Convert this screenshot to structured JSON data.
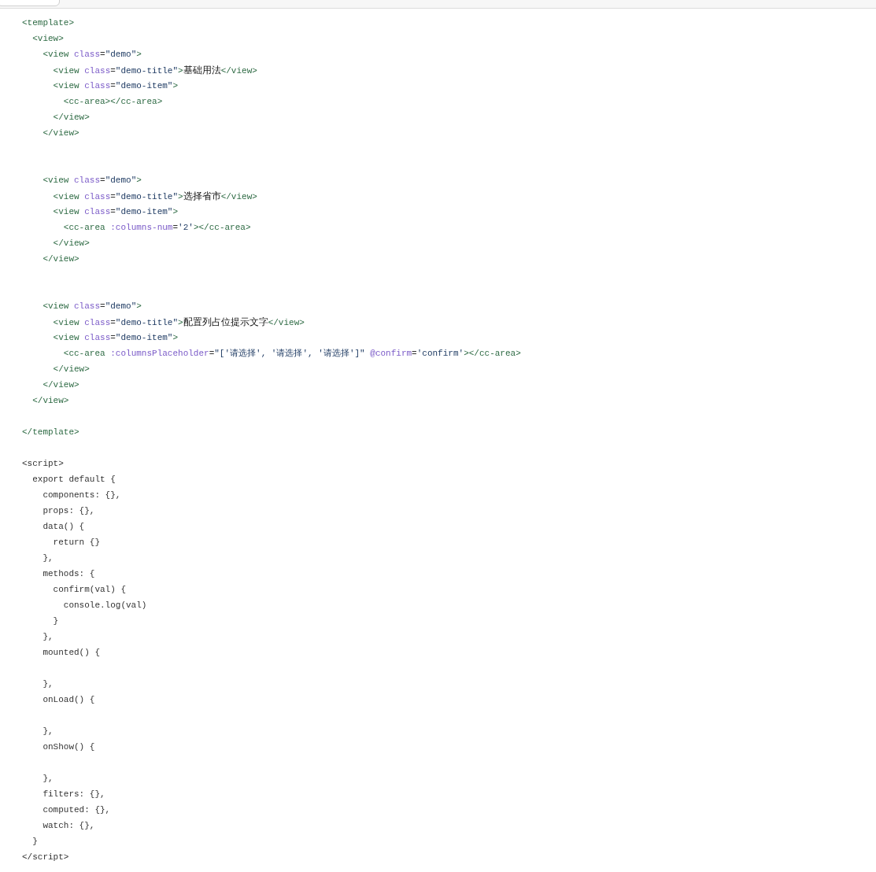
{
  "code": {
    "lines": [
      {
        "kind": "code",
        "tokens": [
          {
            "kind": "tag",
            "text": "<template>"
          }
        ]
      },
      {
        "kind": "code",
        "tokens": [
          {
            "kind": "tag",
            "text": "  <view>"
          }
        ]
      },
      {
        "kind": "code",
        "tokens": [
          {
            "kind": "tag",
            "text": "    <view"
          },
          {
            "kind": "attr",
            "text": " class"
          },
          {
            "kind": "plain",
            "text": "="
          },
          {
            "kind": "string",
            "text": "\"demo\""
          },
          {
            "kind": "tag",
            "text": ">"
          }
        ]
      },
      {
        "kind": "code",
        "tokens": [
          {
            "kind": "tag",
            "text": "      <view"
          },
          {
            "kind": "attr",
            "text": " class"
          },
          {
            "kind": "plain",
            "text": "="
          },
          {
            "kind": "string",
            "text": "\"demo-title\""
          },
          {
            "kind": "tag",
            "text": ">"
          },
          {
            "kind": "text",
            "text": "基础用法"
          },
          {
            "kind": "tag",
            "text": "</view>"
          }
        ]
      },
      {
        "kind": "code",
        "tokens": [
          {
            "kind": "tag",
            "text": "      <view"
          },
          {
            "kind": "attr",
            "text": " class"
          },
          {
            "kind": "plain",
            "text": "="
          },
          {
            "kind": "string",
            "text": "\"demo-item\""
          },
          {
            "kind": "tag",
            "text": ">"
          }
        ]
      },
      {
        "kind": "code",
        "tokens": [
          {
            "kind": "tag",
            "text": "        <cc-area></cc-area>"
          }
        ]
      },
      {
        "kind": "code",
        "tokens": [
          {
            "kind": "tag",
            "text": "      </view>"
          }
        ]
      },
      {
        "kind": "code",
        "tokens": [
          {
            "kind": "tag",
            "text": "    </view>"
          }
        ]
      },
      {
        "kind": "blank"
      },
      {
        "kind": "blank"
      },
      {
        "kind": "code",
        "tokens": [
          {
            "kind": "tag",
            "text": "    <view"
          },
          {
            "kind": "attr",
            "text": " class"
          },
          {
            "kind": "plain",
            "text": "="
          },
          {
            "kind": "string",
            "text": "\"demo\""
          },
          {
            "kind": "tag",
            "text": ">"
          }
        ]
      },
      {
        "kind": "code",
        "tokens": [
          {
            "kind": "tag",
            "text": "      <view"
          },
          {
            "kind": "attr",
            "text": " class"
          },
          {
            "kind": "plain",
            "text": "="
          },
          {
            "kind": "string",
            "text": "\"demo-title\""
          },
          {
            "kind": "tag",
            "text": ">"
          },
          {
            "kind": "text",
            "text": "选择省市"
          },
          {
            "kind": "tag",
            "text": "</view>"
          }
        ]
      },
      {
        "kind": "code",
        "tokens": [
          {
            "kind": "tag",
            "text": "      <view"
          },
          {
            "kind": "attr",
            "text": " class"
          },
          {
            "kind": "plain",
            "text": "="
          },
          {
            "kind": "string",
            "text": "\"demo-item\""
          },
          {
            "kind": "tag",
            "text": ">"
          }
        ]
      },
      {
        "kind": "code",
        "tokens": [
          {
            "kind": "tag",
            "text": "        <cc-area"
          },
          {
            "kind": "attr",
            "text": " :columns-num"
          },
          {
            "kind": "plain",
            "text": "="
          },
          {
            "kind": "string",
            "text": "'2'"
          },
          {
            "kind": "tag",
            "text": "></cc-area>"
          }
        ]
      },
      {
        "kind": "code",
        "tokens": [
          {
            "kind": "tag",
            "text": "      </view>"
          }
        ]
      },
      {
        "kind": "code",
        "tokens": [
          {
            "kind": "tag",
            "text": "    </view>"
          }
        ]
      },
      {
        "kind": "blank"
      },
      {
        "kind": "blank"
      },
      {
        "kind": "code",
        "tokens": [
          {
            "kind": "tag",
            "text": "    <view"
          },
          {
            "kind": "attr",
            "text": " class"
          },
          {
            "kind": "plain",
            "text": "="
          },
          {
            "kind": "string",
            "text": "\"demo\""
          },
          {
            "kind": "tag",
            "text": ">"
          }
        ]
      },
      {
        "kind": "code",
        "tokens": [
          {
            "kind": "tag",
            "text": "      <view"
          },
          {
            "kind": "attr",
            "text": " class"
          },
          {
            "kind": "plain",
            "text": "="
          },
          {
            "kind": "string",
            "text": "\"demo-title\""
          },
          {
            "kind": "tag",
            "text": ">"
          },
          {
            "kind": "text",
            "text": "配置列占位提示文字"
          },
          {
            "kind": "tag",
            "text": "</view>"
          }
        ]
      },
      {
        "kind": "code",
        "tokens": [
          {
            "kind": "tag",
            "text": "      <view"
          },
          {
            "kind": "attr",
            "text": " class"
          },
          {
            "kind": "plain",
            "text": "="
          },
          {
            "kind": "string",
            "text": "\"demo-item\""
          },
          {
            "kind": "tag",
            "text": ">"
          }
        ]
      },
      {
        "kind": "code",
        "tokens": [
          {
            "kind": "tag",
            "text": "        <cc-area"
          },
          {
            "kind": "attr",
            "text": " :columnsPlaceholder"
          },
          {
            "kind": "plain",
            "text": "="
          },
          {
            "kind": "string",
            "text": "\"['请选择', '请选择', '请选择']\""
          },
          {
            "kind": "attr",
            "text": " @confirm"
          },
          {
            "kind": "plain",
            "text": "="
          },
          {
            "kind": "string",
            "text": "'confirm'"
          },
          {
            "kind": "tag",
            "text": "></cc-area>"
          }
        ]
      },
      {
        "kind": "code",
        "tokens": [
          {
            "kind": "tag",
            "text": "      </view>"
          }
        ]
      },
      {
        "kind": "code",
        "tokens": [
          {
            "kind": "tag",
            "text": "    </view>"
          }
        ]
      },
      {
        "kind": "code",
        "tokens": [
          {
            "kind": "tag",
            "text": "  </view>"
          }
        ]
      },
      {
        "kind": "blank"
      },
      {
        "kind": "code",
        "tokens": [
          {
            "kind": "tag",
            "text": "</template>"
          }
        ]
      },
      {
        "kind": "blank"
      },
      {
        "kind": "code",
        "tokens": [
          {
            "kind": "plain",
            "text": "<script>"
          }
        ]
      },
      {
        "kind": "code",
        "tokens": [
          {
            "kind": "plain",
            "text": "  export default {"
          }
        ]
      },
      {
        "kind": "code",
        "tokens": [
          {
            "kind": "plain",
            "text": "    components: {},"
          }
        ]
      },
      {
        "kind": "code",
        "tokens": [
          {
            "kind": "plain",
            "text": "    props: {},"
          }
        ]
      },
      {
        "kind": "code",
        "tokens": [
          {
            "kind": "plain",
            "text": "    data() {"
          }
        ]
      },
      {
        "kind": "code",
        "tokens": [
          {
            "kind": "plain",
            "text": "      return {}"
          }
        ]
      },
      {
        "kind": "code",
        "tokens": [
          {
            "kind": "plain",
            "text": "    },"
          }
        ]
      },
      {
        "kind": "code",
        "tokens": [
          {
            "kind": "plain",
            "text": "    methods: {"
          }
        ]
      },
      {
        "kind": "code",
        "tokens": [
          {
            "kind": "plain",
            "text": "      confirm(val) {"
          }
        ]
      },
      {
        "kind": "code",
        "tokens": [
          {
            "kind": "plain",
            "text": "        console.log(val)"
          }
        ]
      },
      {
        "kind": "code",
        "tokens": [
          {
            "kind": "plain",
            "text": "      }"
          }
        ]
      },
      {
        "kind": "code",
        "tokens": [
          {
            "kind": "plain",
            "text": "    },"
          }
        ]
      },
      {
        "kind": "code",
        "tokens": [
          {
            "kind": "plain",
            "text": "    mounted() {"
          }
        ]
      },
      {
        "kind": "blank"
      },
      {
        "kind": "code",
        "tokens": [
          {
            "kind": "plain",
            "text": "    },"
          }
        ]
      },
      {
        "kind": "code",
        "tokens": [
          {
            "kind": "plain",
            "text": "    onLoad() {"
          }
        ]
      },
      {
        "kind": "blank"
      },
      {
        "kind": "code",
        "tokens": [
          {
            "kind": "plain",
            "text": "    },"
          }
        ]
      },
      {
        "kind": "code",
        "tokens": [
          {
            "kind": "plain",
            "text": "    onShow() {"
          }
        ]
      },
      {
        "kind": "blank"
      },
      {
        "kind": "code",
        "tokens": [
          {
            "kind": "plain",
            "text": "    },"
          }
        ]
      },
      {
        "kind": "code",
        "tokens": [
          {
            "kind": "plain",
            "text": "    filters: {},"
          }
        ]
      },
      {
        "kind": "code",
        "tokens": [
          {
            "kind": "plain",
            "text": "    computed: {},"
          }
        ]
      },
      {
        "kind": "code",
        "tokens": [
          {
            "kind": "plain",
            "text": "    watch: {},"
          }
        ]
      },
      {
        "kind": "code",
        "tokens": [
          {
            "kind": "plain",
            "text": "  }"
          }
        ]
      },
      {
        "kind": "code",
        "tokens": [
          {
            "kind": "plain",
            "text": "</script>"
          }
        ]
      }
    ]
  }
}
